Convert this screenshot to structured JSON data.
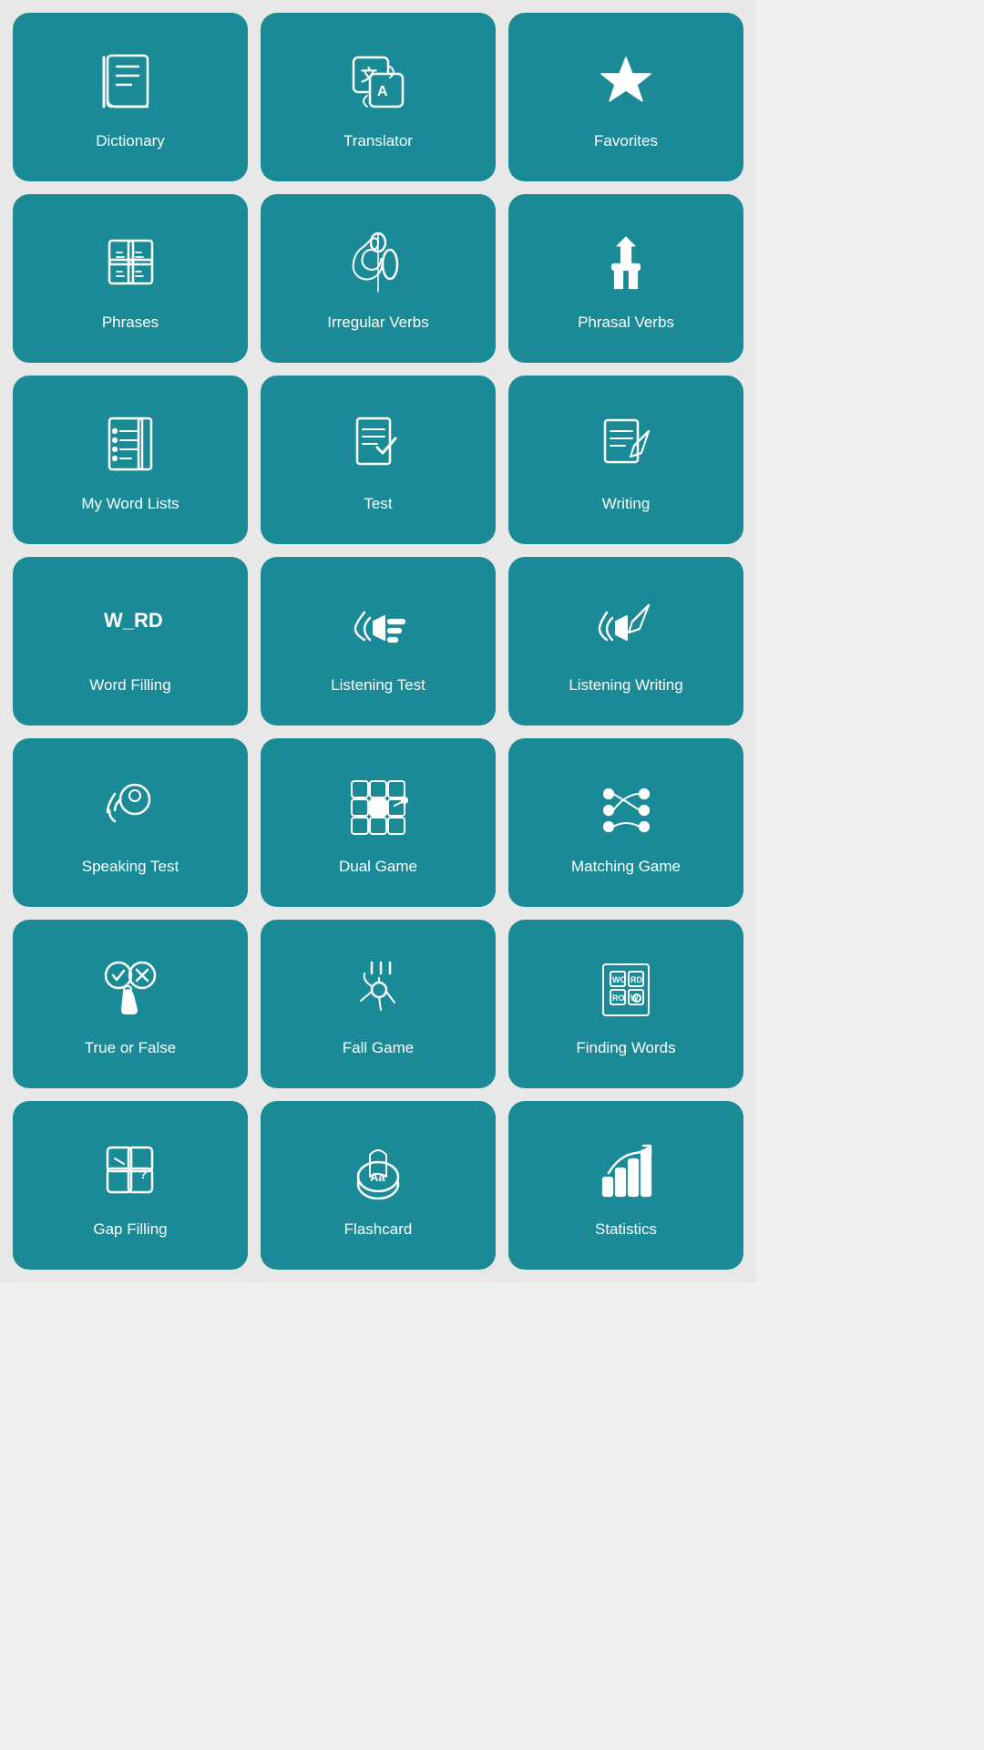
{
  "tiles": [
    {
      "id": "dictionary",
      "label": "Dictionary"
    },
    {
      "id": "translator",
      "label": "Translator"
    },
    {
      "id": "favorites",
      "label": "Favorites"
    },
    {
      "id": "phrases",
      "label": "Phrases"
    },
    {
      "id": "irregular-verbs",
      "label": "Irregular Verbs"
    },
    {
      "id": "phrasal-verbs",
      "label": "Phrasal Verbs"
    },
    {
      "id": "my-word-lists",
      "label": "My Word Lists"
    },
    {
      "id": "test",
      "label": "Test"
    },
    {
      "id": "writing",
      "label": "Writing"
    },
    {
      "id": "word-filling",
      "label": "Word Filling"
    },
    {
      "id": "listening-test",
      "label": "Listening Test"
    },
    {
      "id": "listening-writing",
      "label": "Listening Writing"
    },
    {
      "id": "speaking-test",
      "label": "Speaking Test"
    },
    {
      "id": "dual-game",
      "label": "Dual Game"
    },
    {
      "id": "matching-game",
      "label": "Matching Game"
    },
    {
      "id": "true-or-false",
      "label": "True or False"
    },
    {
      "id": "fall-game",
      "label": "Fall Game"
    },
    {
      "id": "finding-words",
      "label": "Finding Words"
    },
    {
      "id": "gap-filling",
      "label": "Gap Filling"
    },
    {
      "id": "flashcard",
      "label": "Flashcard"
    },
    {
      "id": "statistics",
      "label": "Statistics"
    }
  ]
}
